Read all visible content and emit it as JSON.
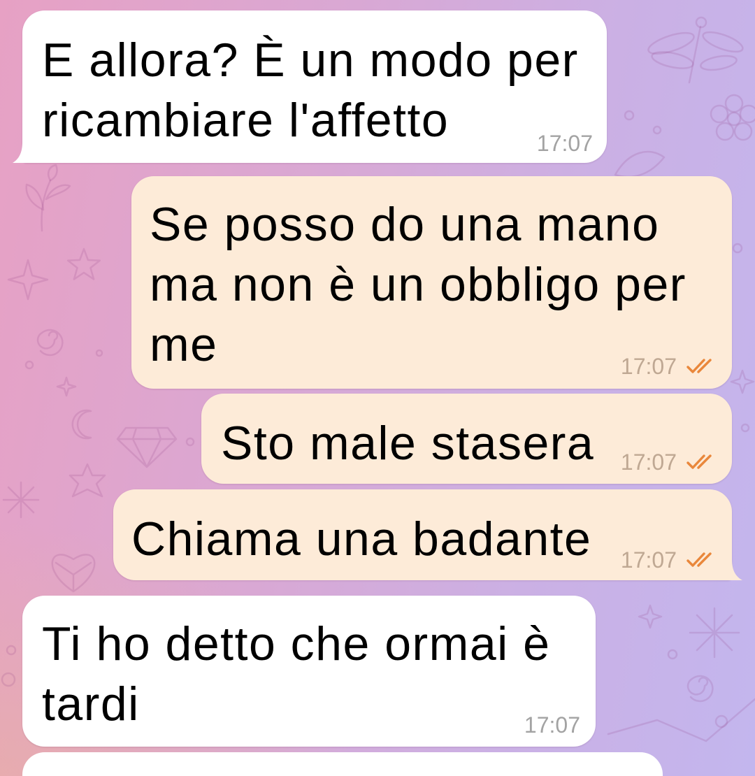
{
  "messages": [
    {
      "outgoing": false,
      "text": "E allora? È un modo per ricambiare l'affetto",
      "time": "17:07"
    },
    {
      "outgoing": true,
      "text": "Se posso do una mano ma non è un obbligo per me",
      "time": "17:07",
      "status_icon": "double-check-icon"
    },
    {
      "outgoing": true,
      "text": "Sto male stasera",
      "time": "17:07",
      "status_icon": "double-check-icon"
    },
    {
      "outgoing": true,
      "text": "Chiama una badante",
      "time": "17:07",
      "status_icon": "double-check-icon"
    },
    {
      "outgoing": false,
      "text": "Ti ho detto che ormai è tardi",
      "time": "17:07"
    }
  ],
  "colors": {
    "incoming_bubble": "#ffffff",
    "outgoing_bubble": "#fdebd8",
    "read_receipt": "#e9873b",
    "wallpaper_left": "#e7a1c4",
    "wallpaper_right": "#c3b6ee"
  }
}
